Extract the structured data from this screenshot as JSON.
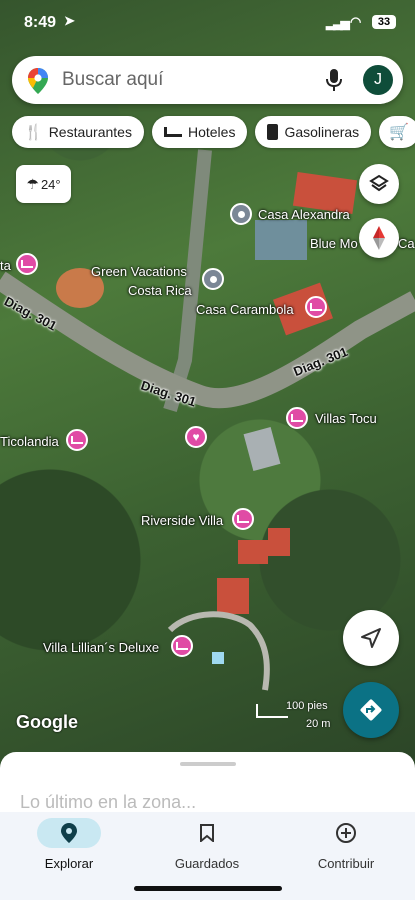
{
  "status_bar": {
    "time": "8:49",
    "battery": "33"
  },
  "search": {
    "placeholder": "Buscar aquí",
    "avatar_initial": "J"
  },
  "chips": [
    {
      "label": "Restaurantes",
      "icon": "fork-knife-icon"
    },
    {
      "label": "Hoteles",
      "icon": "bed-icon"
    },
    {
      "label": "Gasolineras",
      "icon": "gas-station-icon"
    }
  ],
  "weather": {
    "temp": "24°"
  },
  "places": {
    "casa_alexandra": "Casa Alexandra",
    "blue_mo": "Blue Mo",
    "ca": "Ca",
    "green_vacations": "Green Vacations",
    "costa_rica": "Costa Rica",
    "casa_carambola": "Casa Carambola",
    "ta": "ta",
    "villas_tocu": "Villas Tocu",
    "ticolandia": "Ticolandia",
    "riverside_villa": "Riverside Villa",
    "villa_lillian": "Villa Lillian´s Deluxe"
  },
  "roads": {
    "diag_301": "Diag. 301"
  },
  "map_brand": "Google",
  "scale": {
    "feet": "100 pies",
    "meters": "20 m"
  },
  "sheet": {
    "title": "Lo último en la zona..."
  },
  "bottom_nav": [
    {
      "label": "Explorar",
      "active": true
    },
    {
      "label": "Guardados",
      "active": false
    },
    {
      "label": "Contribuir",
      "active": false
    }
  ],
  "colors": {
    "accent_teal": "#0b7285",
    "pin_pink": "#e04ba5",
    "nav_active_bg": "#c9e8f2"
  }
}
